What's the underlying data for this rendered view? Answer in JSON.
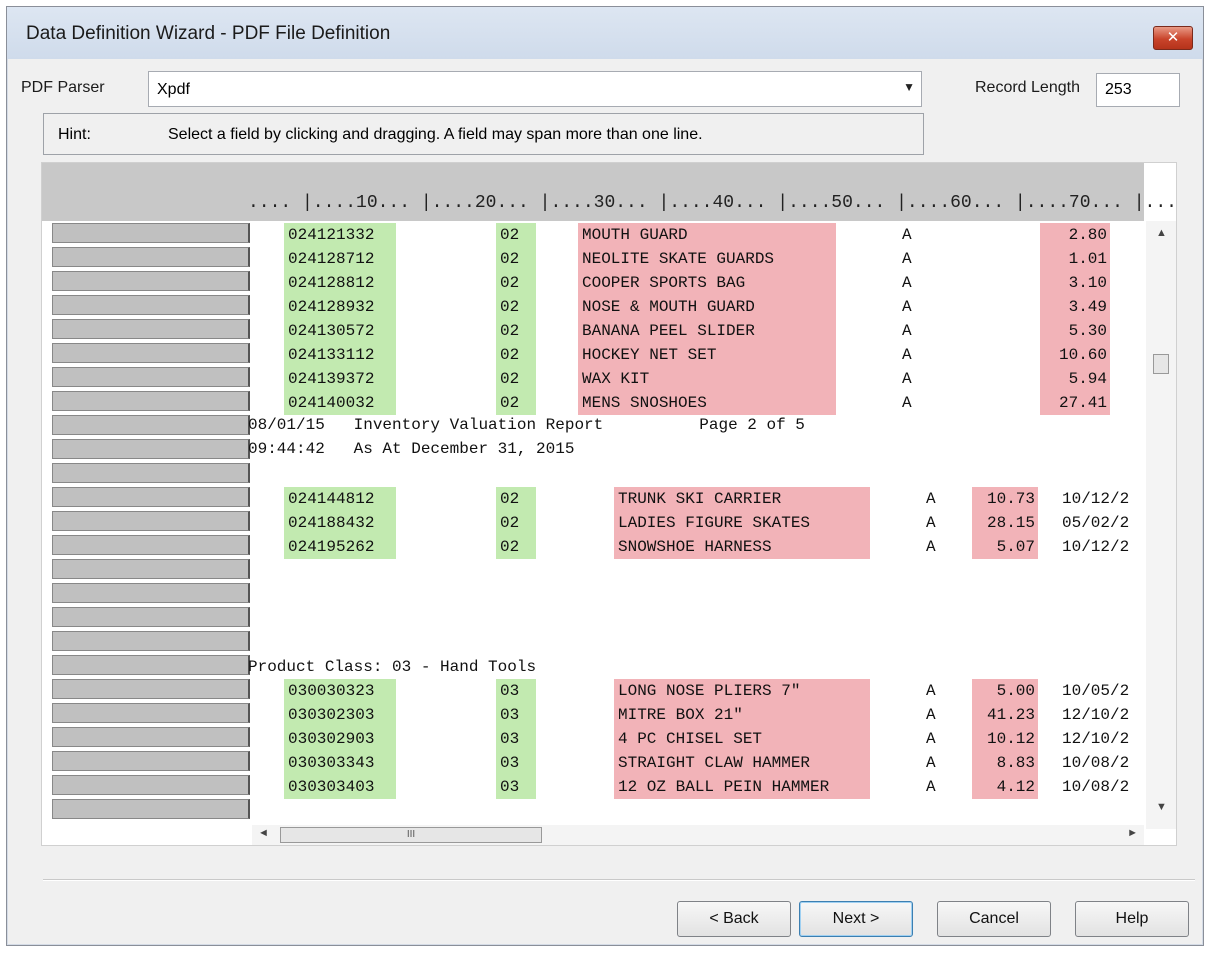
{
  "window": {
    "title": "Data Definition Wizard - PDF File Definition",
    "close_label": "✕"
  },
  "parser": {
    "label": "PDF Parser",
    "value": "Xpdf"
  },
  "record": {
    "label": "Record Length",
    "value": "253"
  },
  "hint": {
    "label": "Hint:",
    "text": "Select a field by clicking and dragging. A field may span more than one line."
  },
  "ruler": ".... |....10... |....20... |....30... |....40... |....50... |....60... |....70... |....",
  "rows": [
    {
      "code": "024121332",
      "cls": "02",
      "desc": "MOUTH GUARD",
      "flag": "A",
      "amt": "2.80",
      "date": ""
    },
    {
      "code": "024128712",
      "cls": "02",
      "desc": "NEOLITE SKATE GUARDS",
      "flag": "A",
      "amt": "1.01",
      "date": ""
    },
    {
      "code": "024128812",
      "cls": "02",
      "desc": "COOPER SPORTS BAG",
      "flag": "A",
      "amt": "3.10",
      "date": ""
    },
    {
      "code": "024128932",
      "cls": "02",
      "desc": "NOSE & MOUTH GUARD",
      "flag": "A",
      "amt": "3.49",
      "date": ""
    },
    {
      "code": "024130572",
      "cls": "02",
      "desc": "BANANA PEEL SLIDER",
      "flag": "A",
      "amt": "5.30",
      "date": ""
    },
    {
      "code": "024133112",
      "cls": "02",
      "desc": "HOCKEY NET SET",
      "flag": "A",
      "amt": "10.60",
      "date": ""
    },
    {
      "code": "024139372",
      "cls": "02",
      "desc": "WAX KIT",
      "flag": "A",
      "amt": "5.94",
      "date": ""
    },
    {
      "code": "024140032",
      "cls": "02",
      "desc": "MENS SNOSHOES",
      "flag": "A",
      "amt": "27.41",
      "date": ""
    },
    {
      "code": "024144812",
      "cls": "02",
      "desc": "TRUNK SKI CARRIER",
      "flag": "A",
      "amt": "10.73",
      "date": "10/12/2"
    },
    {
      "code": "024188432",
      "cls": "02",
      "desc": "LADIES FIGURE SKATES",
      "flag": "A",
      "amt": "28.15",
      "date": "05/02/2"
    },
    {
      "code": "024195262",
      "cls": "02",
      "desc": "SNOWSHOE HARNESS",
      "flag": "A",
      "amt": "5.07",
      "date": "10/12/2"
    },
    {
      "code": "030030323",
      "cls": "03",
      "desc": "LONG NOSE PLIERS 7\"",
      "flag": "A",
      "amt": "5.00",
      "date": "10/05/2"
    },
    {
      "code": "030302303",
      "cls": "03",
      "desc": "MITRE BOX 21\"",
      "flag": "A",
      "amt": "41.23",
      "date": "12/10/2"
    },
    {
      "code": "030302903",
      "cls": "03",
      "desc": "4 PC CHISEL SET",
      "flag": "A",
      "amt": "10.12",
      "date": "12/10/2"
    },
    {
      "code": "030303343",
      "cls": "03",
      "desc": "STRAIGHT CLAW HAMMER",
      "flag": "A",
      "amt": "8.83",
      "date": "10/08/2"
    },
    {
      "code": "030303403",
      "cls": "03",
      "desc": "12 OZ BALL PEIN HAMMER",
      "flag": "A",
      "amt": "4.12",
      "date": "10/08/2"
    }
  ],
  "report": {
    "line1": "08/01/15   Inventory Valuation Report          Page 2 of 5",
    "line2": "09:44:42   As At December 31, 2015",
    "product_class": "Product Class: 03 - Hand Tools"
  },
  "scroll": {
    "up": "▲",
    "down": "▼",
    "left": "◄",
    "right": "►",
    "grip": "III"
  },
  "buttons": {
    "back": "< Back",
    "next": "Next >",
    "cancel": "Cancel",
    "help": "Help"
  }
}
